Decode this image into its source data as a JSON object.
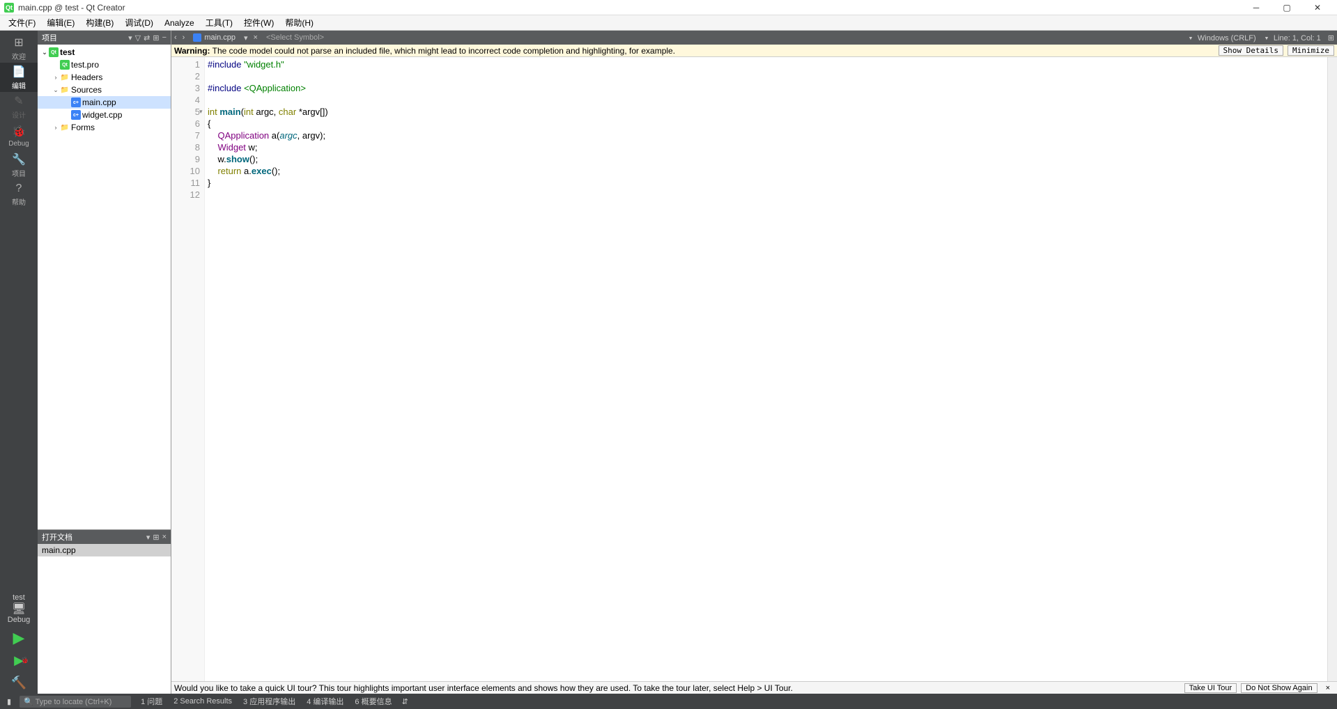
{
  "title": "main.cpp @ test - Qt Creator",
  "menubar": [
    "文件(F)",
    "编辑(E)",
    "构建(B)",
    "调试(D)",
    "Analyze",
    "工具(T)",
    "控件(W)",
    "帮助(H)"
  ],
  "modebar": {
    "items": [
      {
        "label": "欢迎",
        "icon": "⊞"
      },
      {
        "label": "编辑",
        "icon": "📄",
        "active": true
      },
      {
        "label": "设计",
        "icon": "✎",
        "disabled": true
      },
      {
        "label": "Debug",
        "icon": "🐞"
      },
      {
        "label": "项目",
        "icon": "🔧"
      },
      {
        "label": "帮助",
        "icon": "?"
      }
    ],
    "kit_name": "test",
    "kit_config": "Debug"
  },
  "project_pane": {
    "title": "项目",
    "tree": [
      {
        "depth": 0,
        "arrow": "⌄",
        "icon": "qt",
        "label": "test"
      },
      {
        "depth": 1,
        "arrow": "",
        "icon": "qt",
        "label": "test.pro"
      },
      {
        "depth": 1,
        "arrow": "›",
        "icon": "folder",
        "label": "Headers"
      },
      {
        "depth": 1,
        "arrow": "⌄",
        "icon": "folder",
        "label": "Sources"
      },
      {
        "depth": 2,
        "arrow": "",
        "icon": "cpp",
        "label": "main.cpp",
        "selected": true
      },
      {
        "depth": 2,
        "arrow": "",
        "icon": "cpp",
        "label": "widget.cpp"
      },
      {
        "depth": 1,
        "arrow": "›",
        "icon": "folder",
        "label": "Forms"
      }
    ]
  },
  "open_docs": {
    "title": "打开文档",
    "items": [
      "main.cpp"
    ]
  },
  "editor": {
    "tab_file": "main.cpp",
    "symbol_placeholder": "<Select Symbol>",
    "encoding": "Windows (CRLF)",
    "position": "Line: 1, Col: 1",
    "warning_label": "Warning:",
    "warning_text": " The code model could not parse an included file, which might lead to incorrect code completion and highlighting, for example.",
    "warning_show": "Show Details",
    "warning_min": "Minimize",
    "line_count": 12
  },
  "code": {
    "l1_pp": "#include",
    "l1_str": "\"widget.h\"",
    "l3_pp": "#include",
    "l3_inc": "<QApplication>",
    "l5_int": "int",
    "l5_main": "main",
    "l5_open": "(",
    "l5_int2": "int",
    "l5_argc": " argc, ",
    "l5_char": "char",
    "l5_argv": " *argv[])",
    "l6": "{",
    "l7_ind": "    ",
    "l7_type": "QApplication",
    "l7_rest1": " a(",
    "l7_argc": "argc",
    "l7_sep": ", argv);",
    "l8_ind": "    ",
    "l8_type": "Widget",
    "l8_rest": " w;",
    "l9_ind": "    w.",
    "l9_show": "show",
    "l9_rest": "();",
    "l10_ind": "    ",
    "l10_ret": "return",
    "l10_rest1": " a.",
    "l10_exec": "exec",
    "l10_rest2": "();",
    "l11": "}"
  },
  "tour": {
    "text": "Would you like to take a quick UI tour? This tour highlights important user interface elements and shows how they are used. To take the tour later, select Help > UI Tour.",
    "take": "Take UI Tour",
    "dont": "Do Not Show Again"
  },
  "statusbar": {
    "search_placeholder": "Type to locate (Ctrl+K)",
    "panels": [
      "1 问题",
      "2 Search Results",
      "3 应用程序输出",
      "4 编译输出",
      "6 概要信息"
    ]
  }
}
